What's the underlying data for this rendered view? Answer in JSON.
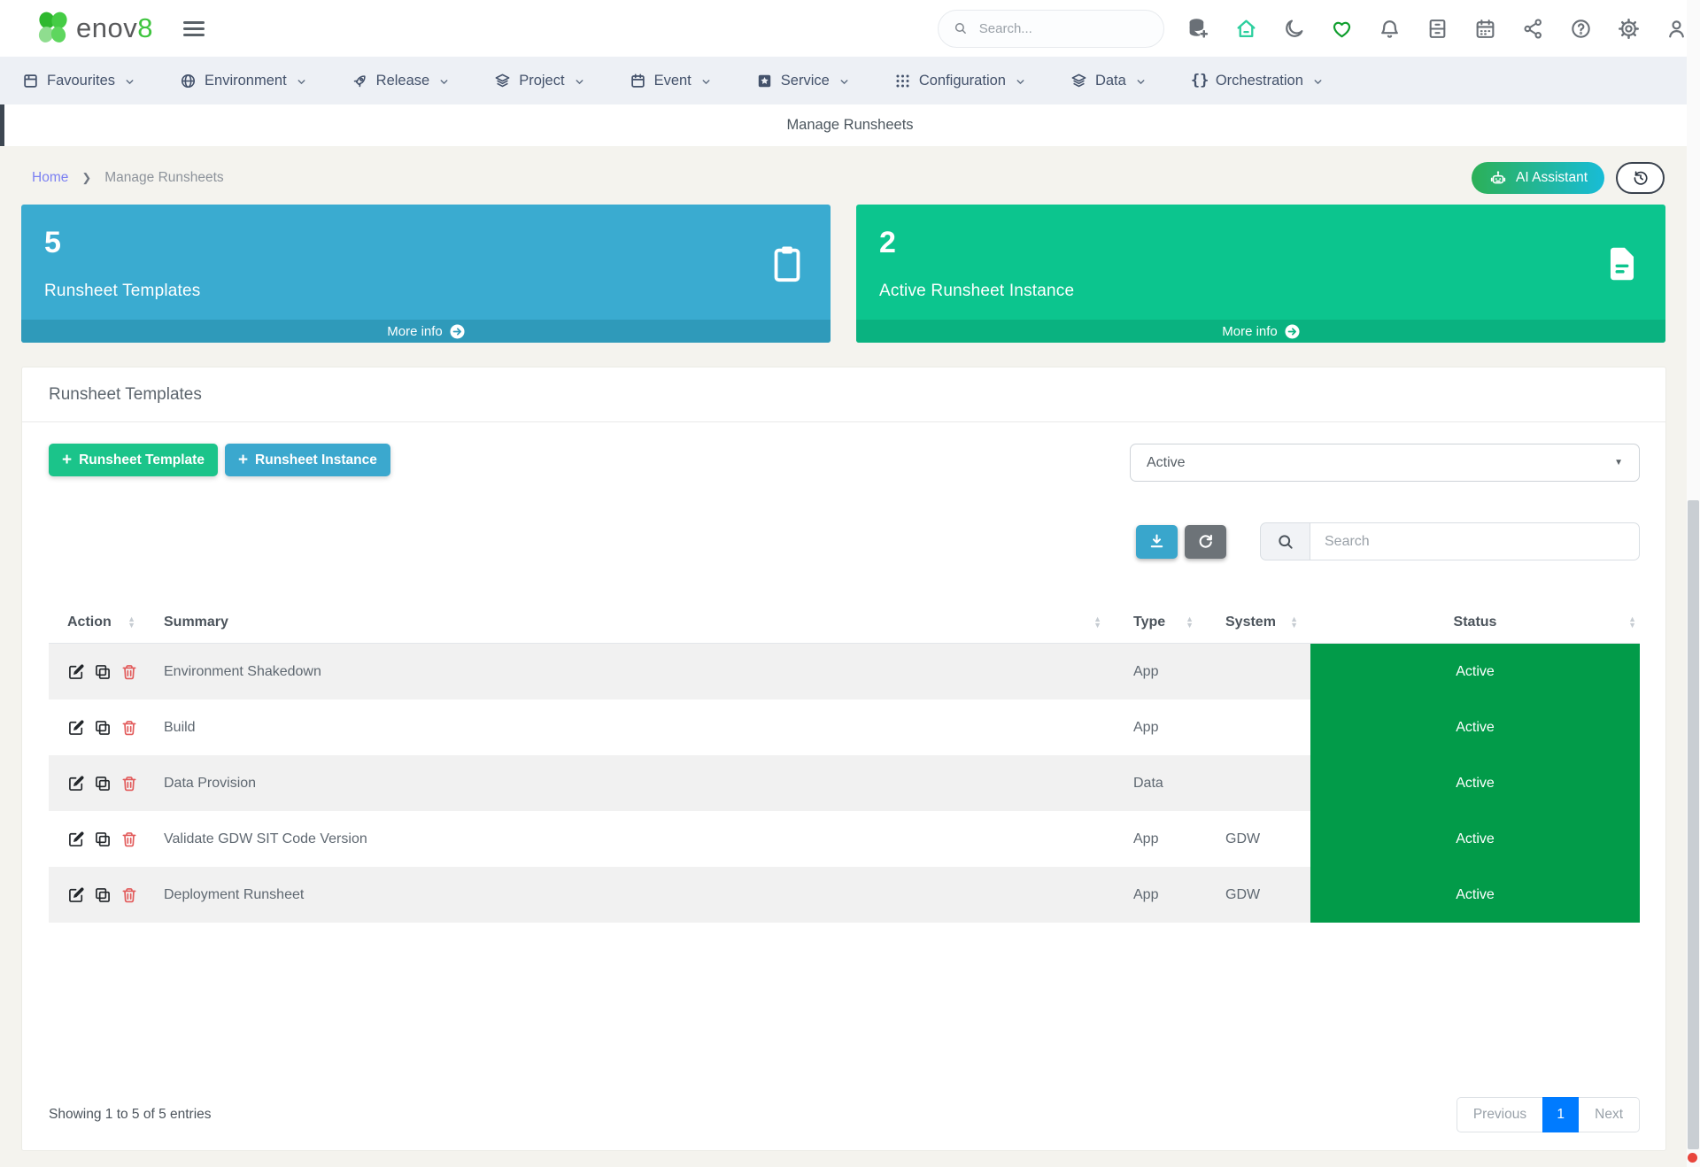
{
  "header": {
    "search_placeholder": "Search...",
    "icons": [
      "data-add",
      "home",
      "dark-mode",
      "favourites",
      "notifications",
      "archive",
      "calendar",
      "share",
      "help",
      "settings",
      "profile"
    ],
    "brand": "enov",
    "brand_suffix": "8"
  },
  "nav": {
    "items": [
      {
        "label": "Favourites",
        "icon": "window"
      },
      {
        "label": "Environment",
        "icon": "globe"
      },
      {
        "label": "Release",
        "icon": "rocket"
      },
      {
        "label": "Project",
        "icon": "layers"
      },
      {
        "label": "Event",
        "icon": "calendar"
      },
      {
        "label": "Service",
        "icon": "star-box"
      },
      {
        "label": "Configuration",
        "icon": "grid"
      },
      {
        "label": "Data",
        "icon": "layers"
      },
      {
        "label": "Orchestration",
        "icon": "braces"
      }
    ]
  },
  "titlebar": {
    "title": "Manage Runsheets"
  },
  "breadcrumb": {
    "home": "Home",
    "current": "Manage Runsheets"
  },
  "actions": {
    "ai_assistant": "AI Assistant"
  },
  "cards": [
    {
      "value": "5",
      "label": "Runsheet Templates",
      "more_info": "More info",
      "icon": "clipboard-icon",
      "color": "#3aabd0",
      "footer_color": "#2f9aba"
    },
    {
      "value": "2",
      "label": "Active Runsheet Instance",
      "more_info": "More info",
      "icon": "file-icon",
      "color": "#0cc58e",
      "footer_color": "#0ab280"
    }
  ],
  "panel": {
    "title": "Runsheet Templates",
    "buttons": {
      "template": "Runsheet Template",
      "instance": "Runsheet Instance"
    },
    "filter": {
      "value": "Active"
    },
    "search_placeholder": "Search",
    "table": {
      "columns": [
        "Action",
        "Summary",
        "Type",
        "System",
        "Status"
      ],
      "rows": [
        {
          "summary": "Environment Shakedown",
          "type": "App",
          "system": "",
          "status": "Active"
        },
        {
          "summary": "Build",
          "type": "App",
          "system": "",
          "status": "Active"
        },
        {
          "summary": "Data Provision",
          "type": "Data",
          "system": "",
          "status": "Active"
        },
        {
          "summary": "Validate GDW SIT Code Version",
          "type": "App",
          "system": "GDW",
          "status": "Active"
        },
        {
          "summary": "Deployment Runsheet",
          "type": "App",
          "system": "GDW",
          "status": "Active"
        }
      ]
    },
    "footer": {
      "showing": "Showing 1 to 5 of 5 entries",
      "previous": "Previous",
      "page": "1",
      "next": "Next"
    }
  },
  "colors": {
    "brand_green": "#3ec43e",
    "card_blue": "#3aabd0",
    "card_green": "#0cc58e",
    "status_green": "#029b49",
    "button_green": "#1bc48a",
    "button_blue": "#3ba8ce",
    "pagination_active": "#007bff",
    "breadcrumb_link": "#7b80f2",
    "ai_gradient_start": "#2cb057",
    "ai_gradient_end": "#18bcd7"
  }
}
